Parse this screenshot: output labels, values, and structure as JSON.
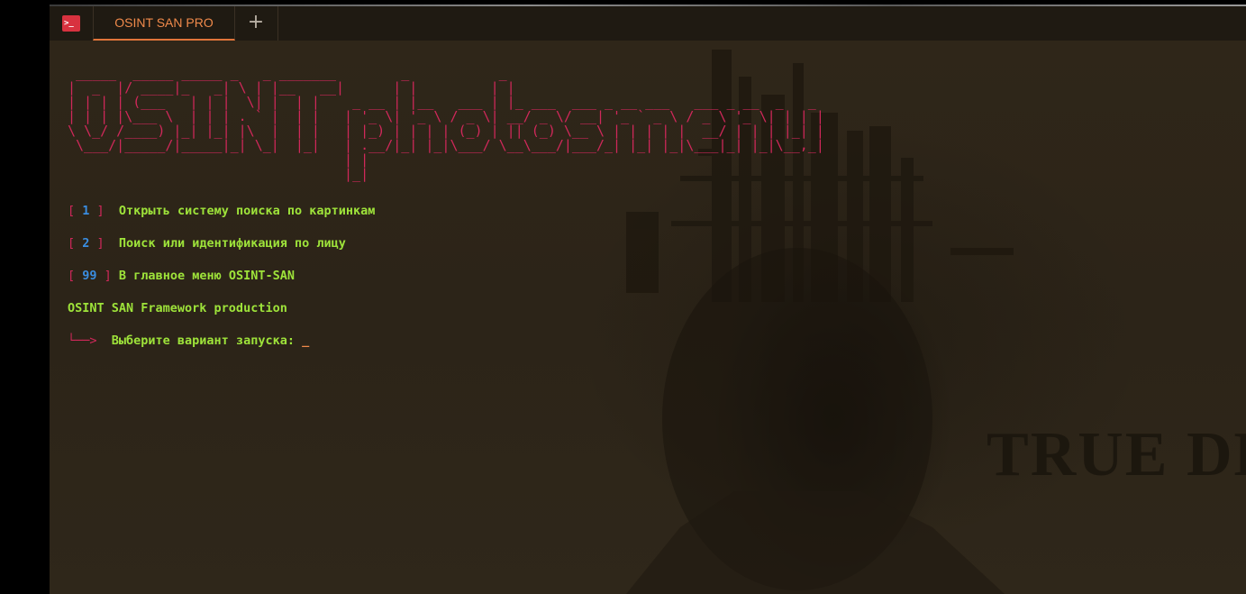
{
  "window": {
    "tab_title": "OSINT SAN PRO",
    "new_tab_symbol": "+",
    "terminal_icon_glyph": ">_"
  },
  "colors": {
    "background": "#2d2417",
    "ascii_banner": "#d0285a",
    "menu_text": "#9ee33a",
    "menu_number": "#3a8de0",
    "tab_accent": "#e0743a"
  },
  "terminal": {
    "banner": " _____  _____ _____ _   _ _______        _           _\n|  _  |/ ____|_   _| \\ | |__   __|      | |         | |\n| | | | (___   | | |  \\| |  | |    _ __ | |__   ___ | |_ ___  ___ _ __ ___   ___ _ __  _   _\n| | | |\\___ \\  | | | . ` |  | |   | '_ \\| '_ \\ / _ \\| __/ _ \\/ __| '_ ` _ \\ / _ \\ '_ \\| | | |\n\\ \\_/ /____) |_| |_| |\\  |  | |   | |_) | | | | (_) | || (_) \\__ \\ | | | | |  __/ | | | |_| |\n \\___/|_____/|_____|_| \\_|  |_|   | .__/|_| |_|\\___/ \\__\\___/|___/_| |_| |_|\\___|_| |_|\\__,_|\n                                  | |\n                                  |_|",
    "options": [
      {
        "open": "[",
        "number": " 1 ",
        "close": "]",
        "label": "  Открыть систему поиска по картинкам"
      },
      {
        "open": "[",
        "number": " 2 ",
        "close": "]",
        "label": "  Поиск или идентификация по лицу"
      },
      {
        "open": "[",
        "number": " 99 ",
        "close": "]",
        "label": " В главное меню OSINT-SAN"
      }
    ],
    "footer": "OSINT SAN Framework production",
    "prompt_arrow": "└──>",
    "prompt": "  Выберите вариант запуска: ",
    "cursor": "_"
  },
  "background": {
    "watermark": "TRUE DE"
  }
}
